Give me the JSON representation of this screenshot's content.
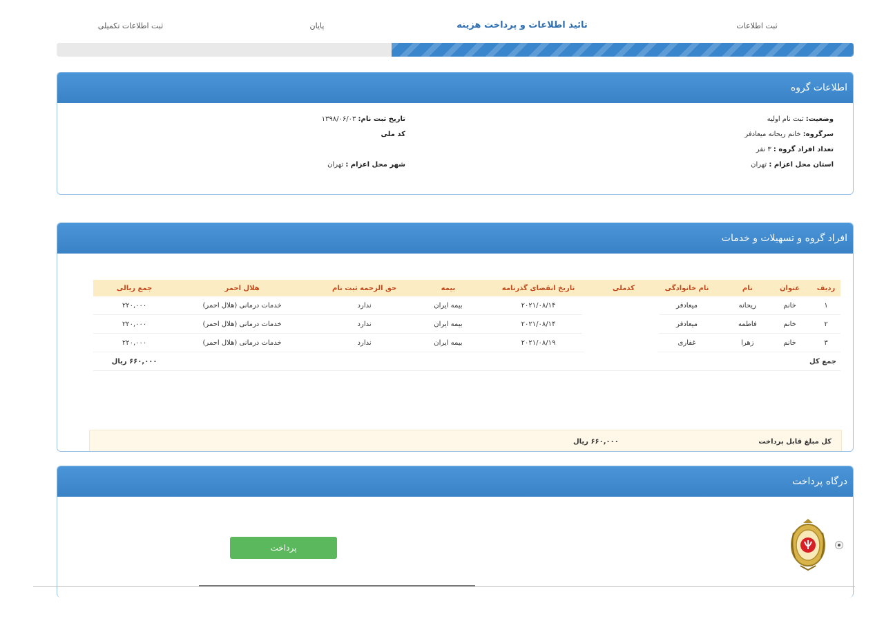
{
  "steps": [
    {
      "label": "ثبت اطلاعات",
      "active": false
    },
    {
      "label": "تائید اطلاعات و پرداخت هزینه",
      "active": true
    },
    {
      "label": "پایان",
      "active": false
    },
    {
      "label": "ثبت اطلاعات تکمیلی",
      "active": false
    }
  ],
  "progress_fraction": 0.58,
  "colors": {
    "accent": "#3a86cc",
    "header_blue": "#4a95d8",
    "button_green": "#5cb85c",
    "table_header_bg": "#fcecc4",
    "table_header_text": "#c04b1e"
  },
  "group_info": {
    "title": "اطلاعات گروه",
    "status_label": "وضعیت:",
    "status_value": " ثبت نام اولیه",
    "leader_label": "سرگروه:",
    "leader_value": " خانم ریحانه میعادفر",
    "count_label": "تعداد افراد گروه :",
    "count_value": " ۳ نفر",
    "province_label": "استان محل اعزام :",
    "province_value": " تهران",
    "reg_date_label": "تاریخ ثبت نام:",
    "reg_date_value": " ۱۳۹۸/۰۶/۰۳",
    "national_code_label": "کد ملی",
    "city_label": "شهر محل اعزام :",
    "city_value": " تهران"
  },
  "members": {
    "title": "افراد گروه و تسهیلات و خدمات",
    "columns": [
      "ردیف",
      "عنوان",
      "نام",
      "نام خانوادگی",
      "کدملی",
      "تاریخ انقضای گذرنامه",
      "بیمه",
      "حق الزحمه ثبت نام",
      "هلال احمر",
      "جمع ریالی"
    ],
    "rows": [
      [
        "۱",
        "خانم",
        "ریحانه",
        "میعادفر",
        "",
        "۲۰۲۱/۰۸/۱۴",
        "بیمه ایران",
        "ندارد",
        "خدمات درمانی (هلال احمر)",
        "۲۲۰,۰۰۰"
      ],
      [
        "۲",
        "خانم",
        "فاطمه",
        "میعادفر",
        "",
        "۲۰۲۱/۰۸/۱۴",
        "بیمه ایران",
        "ندارد",
        "خدمات درمانی (هلال احمر)",
        "۲۲۰,۰۰۰"
      ],
      [
        "۳",
        "خانم",
        "زهرا",
        "غفاری",
        "",
        "۲۰۲۱/۰۸/۱۹",
        "بیمه ایران",
        "ندارد",
        "خدمات درمانی (هلال احمر)",
        "۲۲۰,۰۰۰"
      ]
    ],
    "total_label": "جمع کل",
    "total_value": "۶۶۰,۰۰۰ ریال",
    "payable_label": "کل مبلغ قابل پرداخت",
    "payable_value": "۶۶۰,۰۰۰ ریال"
  },
  "payment": {
    "title": "درگاه پرداخت",
    "button_label": "پرداخت",
    "bank_logo_icon": "bank-melli-logo-icon",
    "radio_selected": true
  }
}
